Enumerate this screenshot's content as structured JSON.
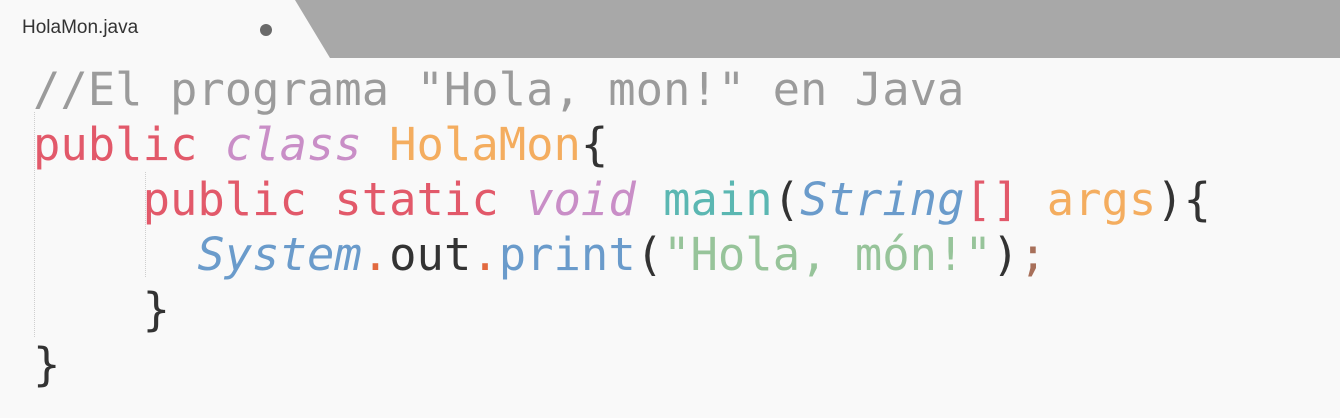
{
  "tab": {
    "filename": "HolaMon.java",
    "modified_indicator": "unsaved-dot"
  },
  "colors": {
    "comment": "#9b9b9b",
    "keyword": "#e2596a",
    "storage": "#c98ec7",
    "class_name": "#f4ad5f",
    "function": "#5bb7b2",
    "type": "#6a9bcb",
    "string": "#97c49a",
    "plain": "#333333",
    "background": "#f9f9f9",
    "tabbar": "#a8a8a8"
  },
  "code": {
    "line1": {
      "comment": "//El programa \"Hola, mon!\" en Java"
    },
    "line2": {
      "kw_public": "public",
      "kw_class": "class",
      "class_name": "HolaMon",
      "brace": "{"
    },
    "line3": {
      "indent": "    ",
      "kw_public": "public",
      "kw_static": "static",
      "kw_void": "void",
      "method": "main",
      "open_paren": "(",
      "type": "String",
      "brackets": "[]",
      "param": "args",
      "close": "){"
    },
    "line4": {
      "indent": "      ",
      "object": "System",
      "dot1": ".",
      "field": "out",
      "dot2": ".",
      "method": "print",
      "open_paren": "(",
      "string": "\"Hola, món!\"",
      "close_paren": ")",
      "semicolon": ";"
    },
    "line5": {
      "indent": "    ",
      "brace": "}"
    },
    "line6": {
      "brace": "}"
    }
  }
}
